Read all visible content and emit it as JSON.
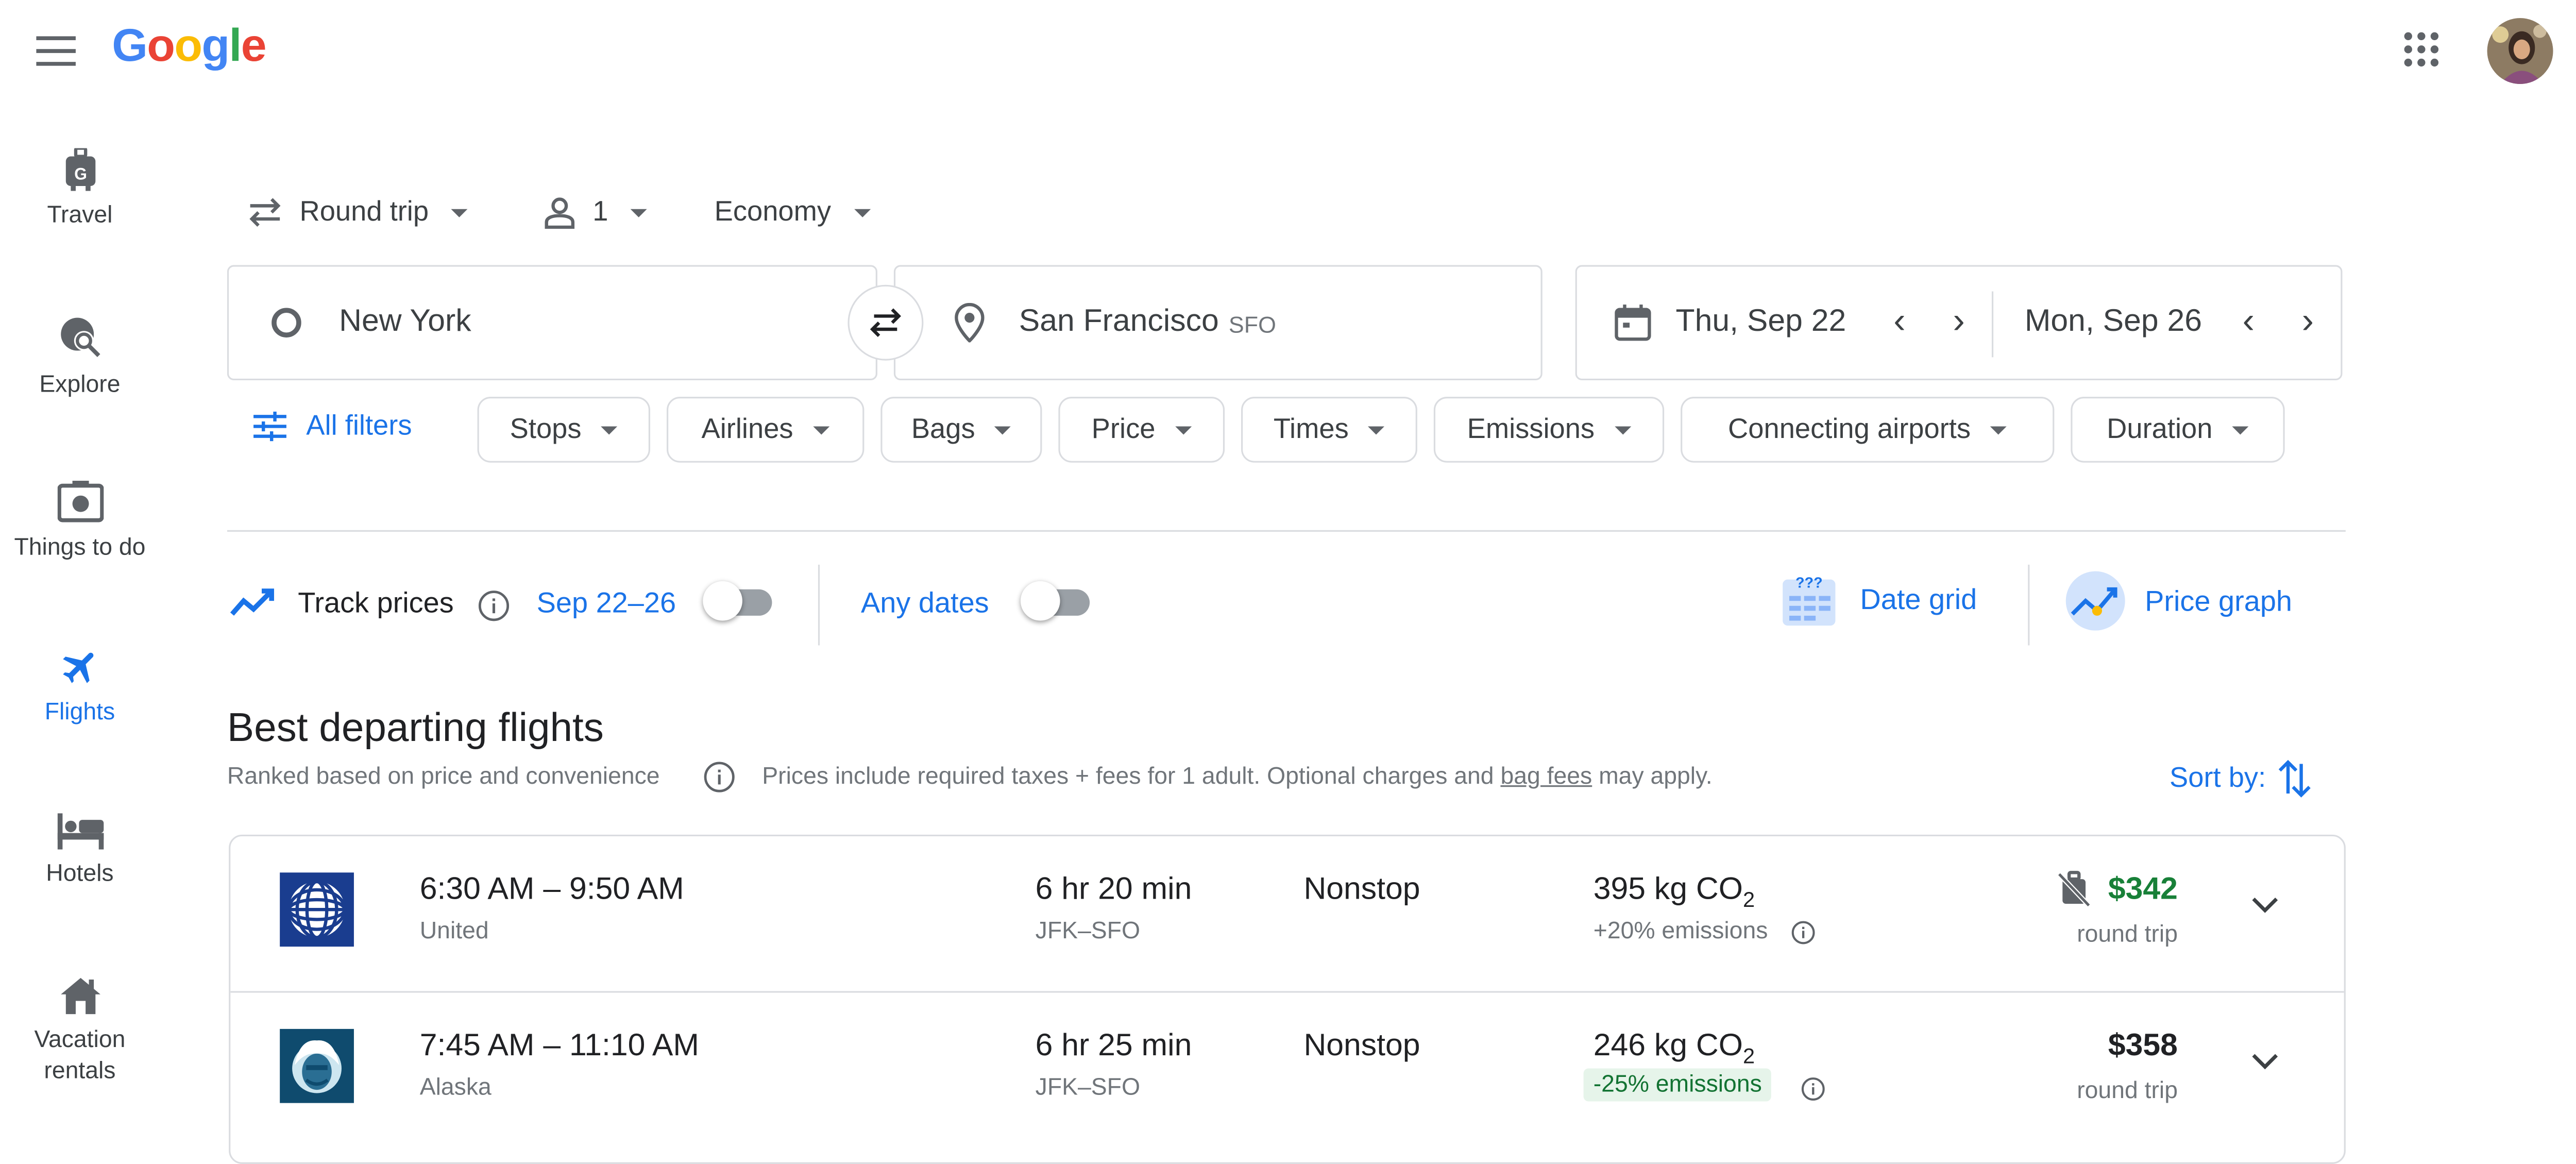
{
  "header": {
    "logo": [
      "G",
      "o",
      "o",
      "g",
      "l",
      "e"
    ],
    "logo_colors": [
      "#4285F4",
      "#EA4335",
      "#FBBC05",
      "#4285F4",
      "#34A853",
      "#EA4335"
    ]
  },
  "sidebar": {
    "items": [
      {
        "label": "Travel",
        "icon": "luggage-icon"
      },
      {
        "label": "Explore",
        "icon": "explore-icon"
      },
      {
        "label": "Things to do",
        "icon": "camera-icon"
      },
      {
        "label": "Flights",
        "icon": "airplane-icon",
        "active": true
      },
      {
        "label": "Hotels",
        "icon": "bed-icon"
      },
      {
        "label": "Vacation rentals",
        "icon": "house-icon"
      }
    ]
  },
  "trip_options": {
    "trip_type": "Round trip",
    "passengers": "1",
    "cabin_class": "Economy"
  },
  "search": {
    "origin": "New York",
    "destination": "San Francisco",
    "destination_code": "SFO",
    "depart_date": "Thu, Sep 22",
    "return_date": "Mon, Sep 26"
  },
  "filters": {
    "all_filters": "All filters",
    "chips": [
      "Stops",
      "Airlines",
      "Bags",
      "Price",
      "Times",
      "Emissions",
      "Connecting airports",
      "Duration"
    ]
  },
  "tracking": {
    "track_prices": "Track prices",
    "date_range": "Sep 22–26",
    "track_enabled": false,
    "any_dates": "Any dates",
    "any_dates_enabled": false,
    "date_grid": "Date grid",
    "price_graph": "Price graph"
  },
  "results": {
    "heading": "Best departing flights",
    "ranked_note": "Ranked based on price and convenience",
    "prices_note_prefix": "Prices include required taxes + fees for 1 adult. Optional charges and ",
    "bag_fees_link": "bag fees",
    "prices_note_suffix": " may apply.",
    "sort_label": "Sort by:",
    "flights": [
      {
        "times": "6:30 AM – 9:50 AM",
        "airline": "United",
        "duration": "6 hr 20 min",
        "route": "JFK–SFO",
        "stops": "Nonstop",
        "co2_value": "395 kg CO",
        "co2_sub": "2",
        "emissions": "+20% emissions",
        "price": "$342",
        "price_color": "#188038",
        "price_note": "round trip",
        "no_carry_on_icon": true
      },
      {
        "times": "7:45 AM – 11:10 AM",
        "airline": "Alaska",
        "duration": "6 hr 25 min",
        "route": "JFK–SFO",
        "stops": "Nonstop",
        "co2_value": "246 kg CO",
        "co2_sub": "2",
        "emissions": "-25% emissions",
        "price": "$358",
        "price_color": "#202124",
        "price_note": "round trip",
        "no_carry_on_icon": false
      }
    ]
  }
}
